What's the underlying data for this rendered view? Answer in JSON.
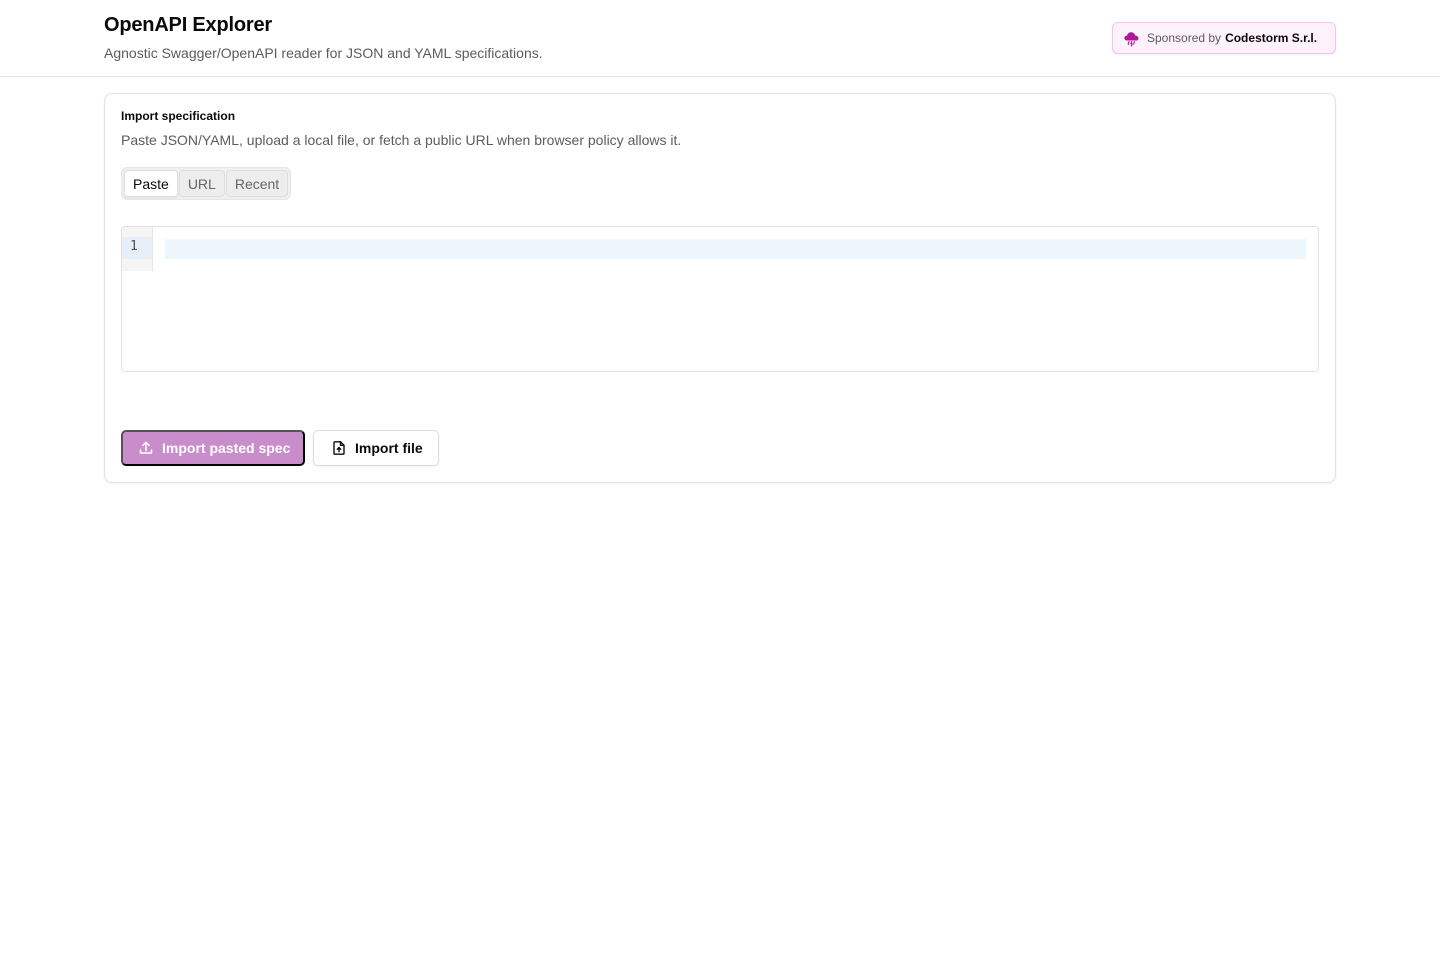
{
  "header": {
    "title": "OpenAPI Explorer",
    "subtitle": "Agnostic Swagger/OpenAPI reader for JSON and YAML specifications.",
    "sponsor": {
      "prefix": "Sponsored by",
      "brand": "Codestorm S.r.l.",
      "icon": "storm-cloud-icon",
      "accent_color": "#b2169a"
    }
  },
  "import_card": {
    "title": "Import specification",
    "description": "Paste JSON/YAML, upload a local file, or fetch a public URL when browser policy allows it.",
    "tabs": [
      {
        "label": "Paste",
        "active": true
      },
      {
        "label": "URL",
        "active": false
      },
      {
        "label": "Recent",
        "active": false
      }
    ],
    "editor": {
      "line_numbers": [
        "1"
      ],
      "content": ""
    },
    "buttons": {
      "import_pasted": {
        "label": "Import pasted spec",
        "icon": "upload-icon",
        "color": "#c98dcc"
      },
      "import_file": {
        "label": "Import file",
        "icon": "file-upload-icon"
      }
    }
  }
}
